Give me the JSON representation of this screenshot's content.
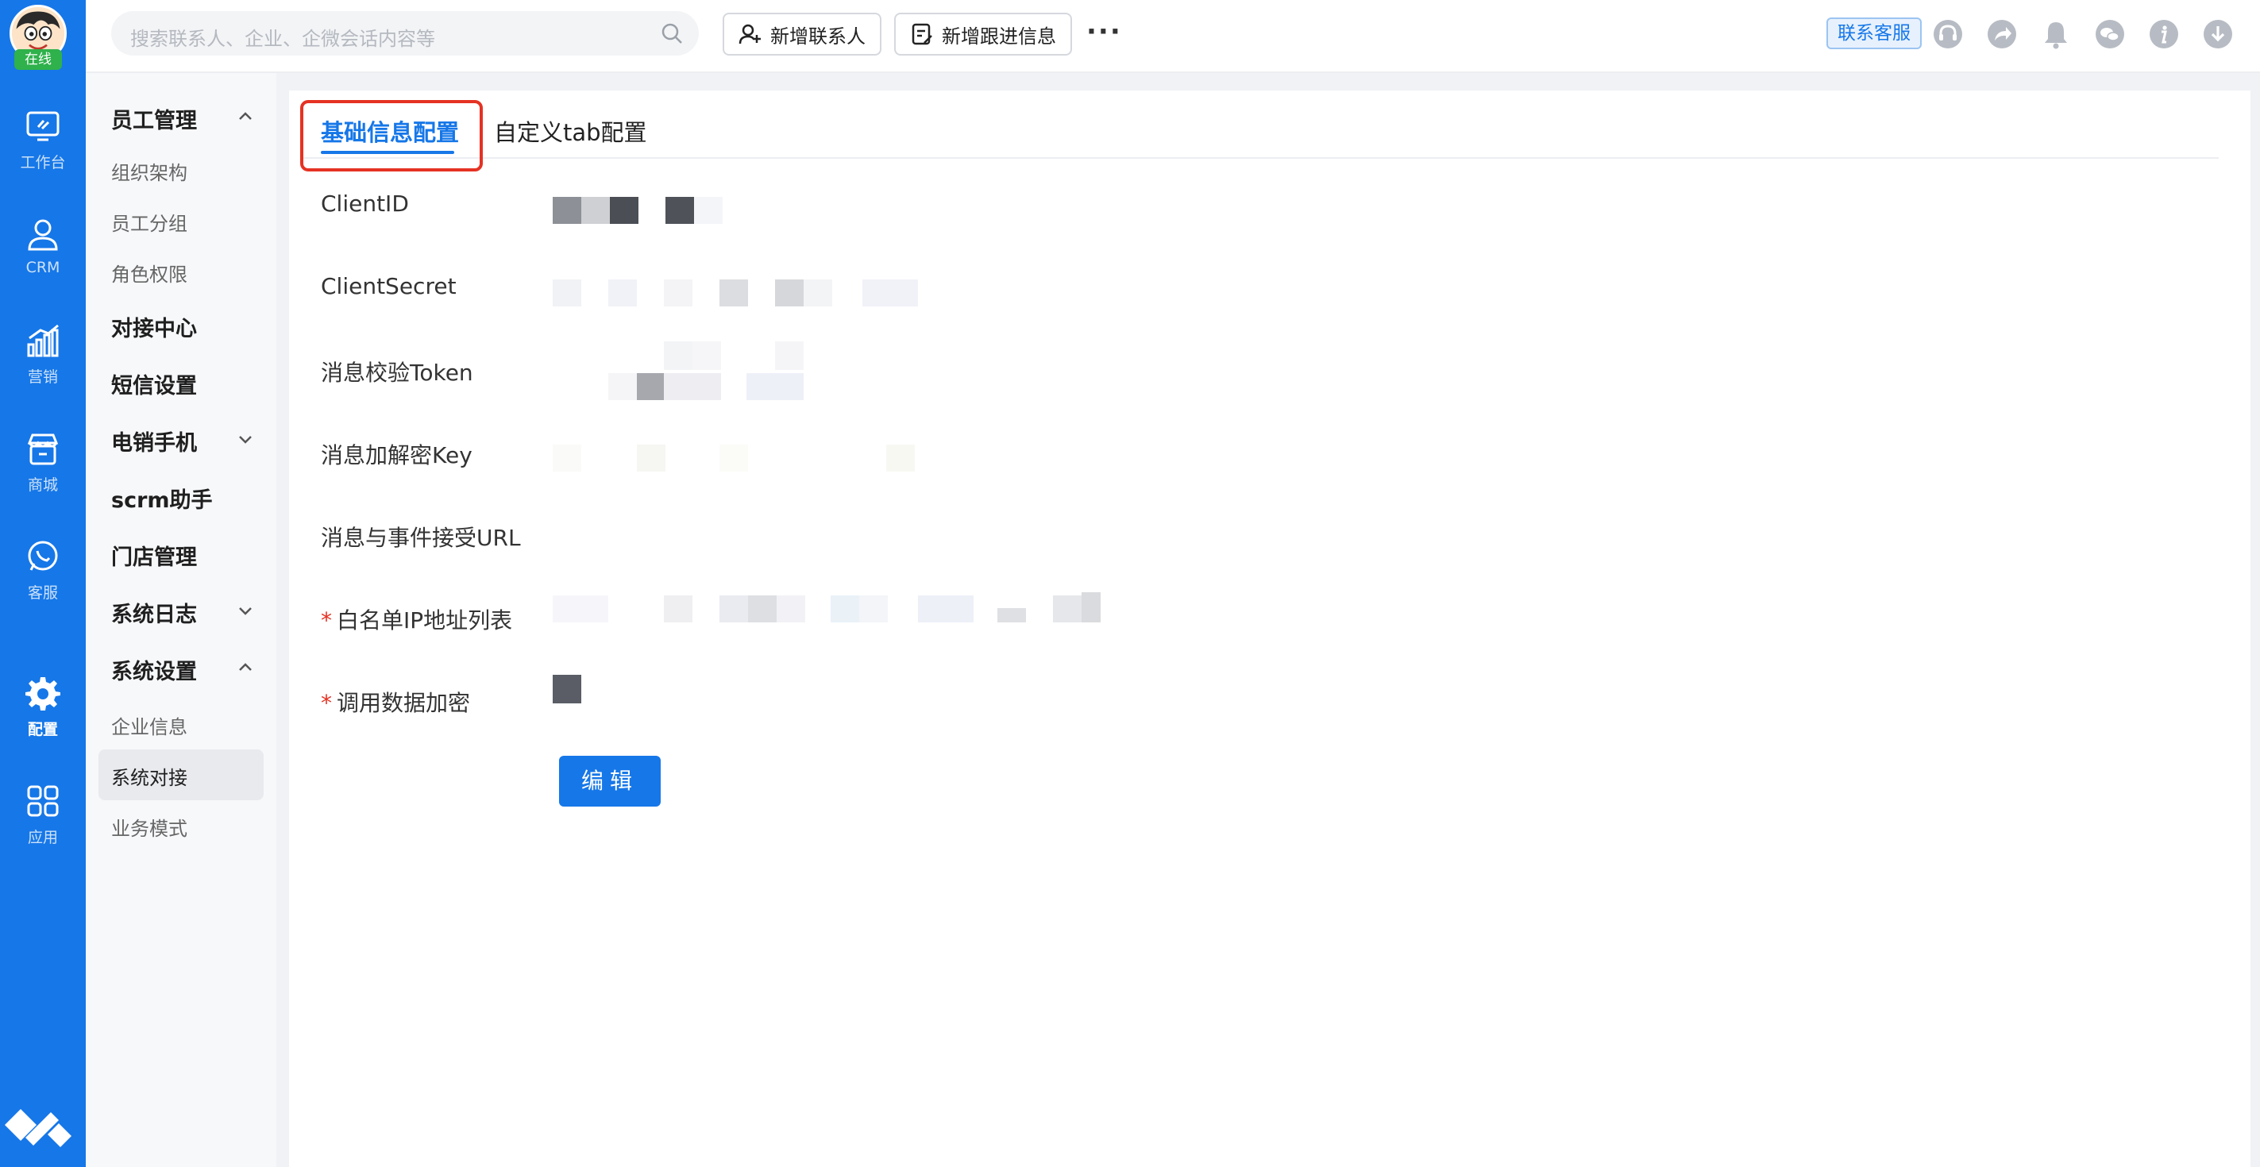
{
  "rail": {
    "status": "在线",
    "items": [
      {
        "label": "工作台",
        "icon": "workbench-icon"
      },
      {
        "label": "CRM",
        "icon": "crm-user-icon"
      },
      {
        "label": "营销",
        "icon": "marketing-chart-icon"
      },
      {
        "label": "商城",
        "icon": "shop-icon"
      },
      {
        "label": "客服",
        "icon": "customer-service-icon"
      },
      {
        "label": "配置",
        "icon": "gear-icon"
      },
      {
        "label": "应用",
        "icon": "apps-grid-icon"
      }
    ],
    "active": "配置"
  },
  "topbar": {
    "search_placeholder": "搜索联系人、企业、企微会话内容等",
    "add_contact": "新增联系人",
    "add_followup": "新增跟进信息",
    "more": "···",
    "contact_service": "联系客服"
  },
  "subnav": {
    "groups": [
      {
        "label": "员工管理",
        "expanded": true,
        "children": [
          "组织架构",
          "员工分组",
          "角色权限"
        ]
      },
      {
        "label": "对接中心"
      },
      {
        "label": "短信设置"
      },
      {
        "label": "电销手机",
        "expanded": false
      },
      {
        "label": "scrm助手"
      },
      {
        "label": "门店管理"
      },
      {
        "label": "系统日志",
        "expanded": false
      },
      {
        "label": "系统设置",
        "expanded": true,
        "children": [
          "企业信息",
          "系统对接",
          "业务模式"
        ]
      }
    ],
    "active": "系统对接"
  },
  "main": {
    "tabs": [
      {
        "label": "基础信息配置",
        "active": true
      },
      {
        "label": "自定义tab配置",
        "active": false
      }
    ],
    "fields": [
      {
        "label": "ClientID",
        "required": false
      },
      {
        "label": "ClientSecret",
        "required": false
      },
      {
        "label": "消息校验Token",
        "required": false
      },
      {
        "label": "消息加解密Key",
        "required": false
      },
      {
        "label": "消息与事件接受URL",
        "required": false
      },
      {
        "label": "白名单IP地址列表",
        "required": true
      },
      {
        "label": "调用数据加密",
        "required": true
      }
    ],
    "required_mark": "*",
    "edit_button": "编辑",
    "accent_color": "#1677e8",
    "highlight_color": "#e53223"
  }
}
